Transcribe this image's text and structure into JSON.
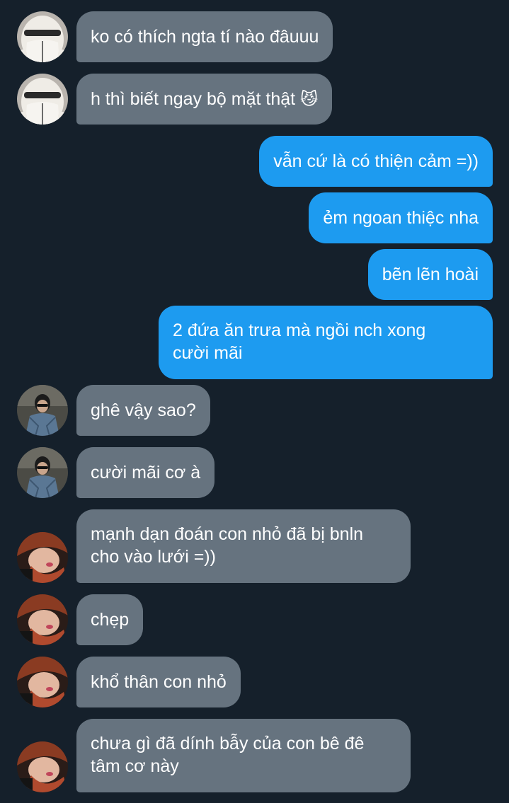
{
  "messages": [
    {
      "from": "them",
      "text": "ko có thích ngta tí nào đâuuu",
      "avatar": "white-hood-avatar"
    },
    {
      "from": "them",
      "text": "h thì biết ngay bộ mặt thật",
      "emoji": "😼",
      "avatar": "white-hood-avatar"
    },
    {
      "from": "me",
      "text": "vẫn cứ là có thiện cảm =))"
    },
    {
      "from": "me",
      "text": "ẻm ngoan thiệc nha"
    },
    {
      "from": "me",
      "text": "bẽn lẽn hoài"
    },
    {
      "from": "me",
      "lines": [
        "2 đứa ăn trưa mà ngồi nch xong",
        "cười mãi"
      ]
    },
    {
      "from": "them",
      "text": "ghê vậy sao?",
      "avatar": "denim-jacket-avatar"
    },
    {
      "from": "them",
      "text": "cười mãi cơ à",
      "avatar": "denim-jacket-avatar"
    },
    {
      "from": "them",
      "lines": [
        "mạnh dạn đoán con nhỏ đã bị bnln",
        "cho vào lưới =))"
      ],
      "avatar": "red-hair-avatar"
    },
    {
      "from": "them",
      "text": "chẹp",
      "avatar": "red-hair-avatar"
    },
    {
      "from": "them",
      "text": "khổ thân con nhỏ",
      "avatar": "red-hair-avatar"
    },
    {
      "from": "them",
      "lines": [
        "chưa gì đã dính bẫy của con bê đê",
        "tâm cơ này"
      ],
      "avatar": "red-hair-avatar"
    }
  ],
  "colors": {
    "background": "#15202b",
    "incoming_bubble": "#66737f",
    "outgoing_bubble": "#1d9bf0",
    "text": "#ffffff"
  }
}
